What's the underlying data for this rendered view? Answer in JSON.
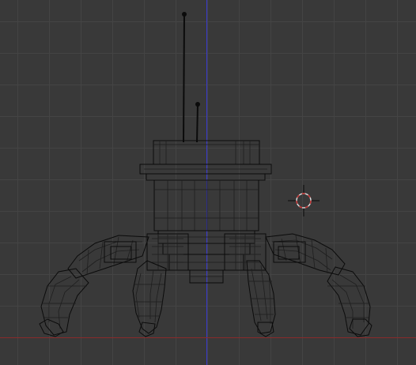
{
  "viewport": {
    "view": "3D viewport",
    "shading": "wireframe",
    "background_color": "#393939",
    "grid_color": "#444444",
    "wire_color": "#0b0b0b"
  },
  "axes": {
    "vertical_axis_color": "#3a3ad0",
    "horizontal_axis_color": "#8b2a2a"
  },
  "cursor": {
    "name": "3d-cursor",
    "ring_colors": [
      "#d8d8d8",
      "#c83232"
    ]
  },
  "model": {
    "object": "spider-robot",
    "parts": [
      "antenna-long",
      "antenna-short",
      "body-cylinder",
      "leg-front-left",
      "leg-inner-left",
      "leg-inner-right",
      "leg-front-right"
    ]
  }
}
